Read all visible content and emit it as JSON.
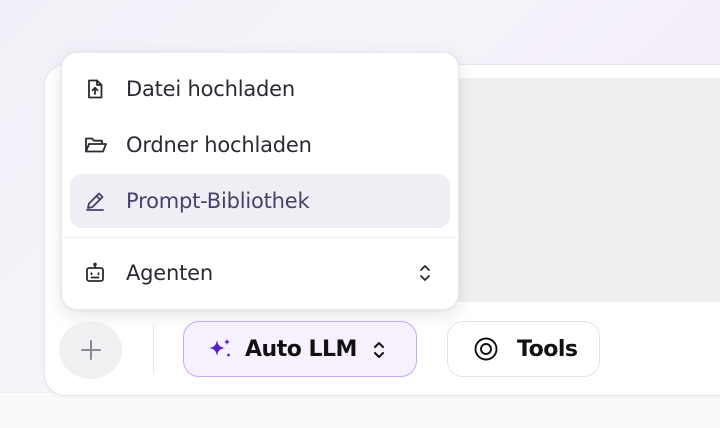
{
  "menu": {
    "items": [
      {
        "label": "Datei hochladen",
        "icon": "file-upload-icon"
      },
      {
        "label": "Ordner hochladen",
        "icon": "folder-open-icon"
      },
      {
        "label": "Prompt-Bibliothek",
        "icon": "pen-icon",
        "active": true
      },
      {
        "label": "Agenten",
        "icon": "robot-icon",
        "chevron": "chevron-up-down-icon"
      }
    ]
  },
  "toolbar": {
    "plus_icon": "plus-icon",
    "model_label": "Auto LLM",
    "model_icon": "sparkle-icon",
    "tools_label": "Tools",
    "tools_icon": "tools-target-icon"
  },
  "colors": {
    "accent": "#6a2ed6",
    "accent_bg": "#f6f0ff",
    "accent_border": "#c9a8f5",
    "active_item_bg": "#efeef4"
  }
}
